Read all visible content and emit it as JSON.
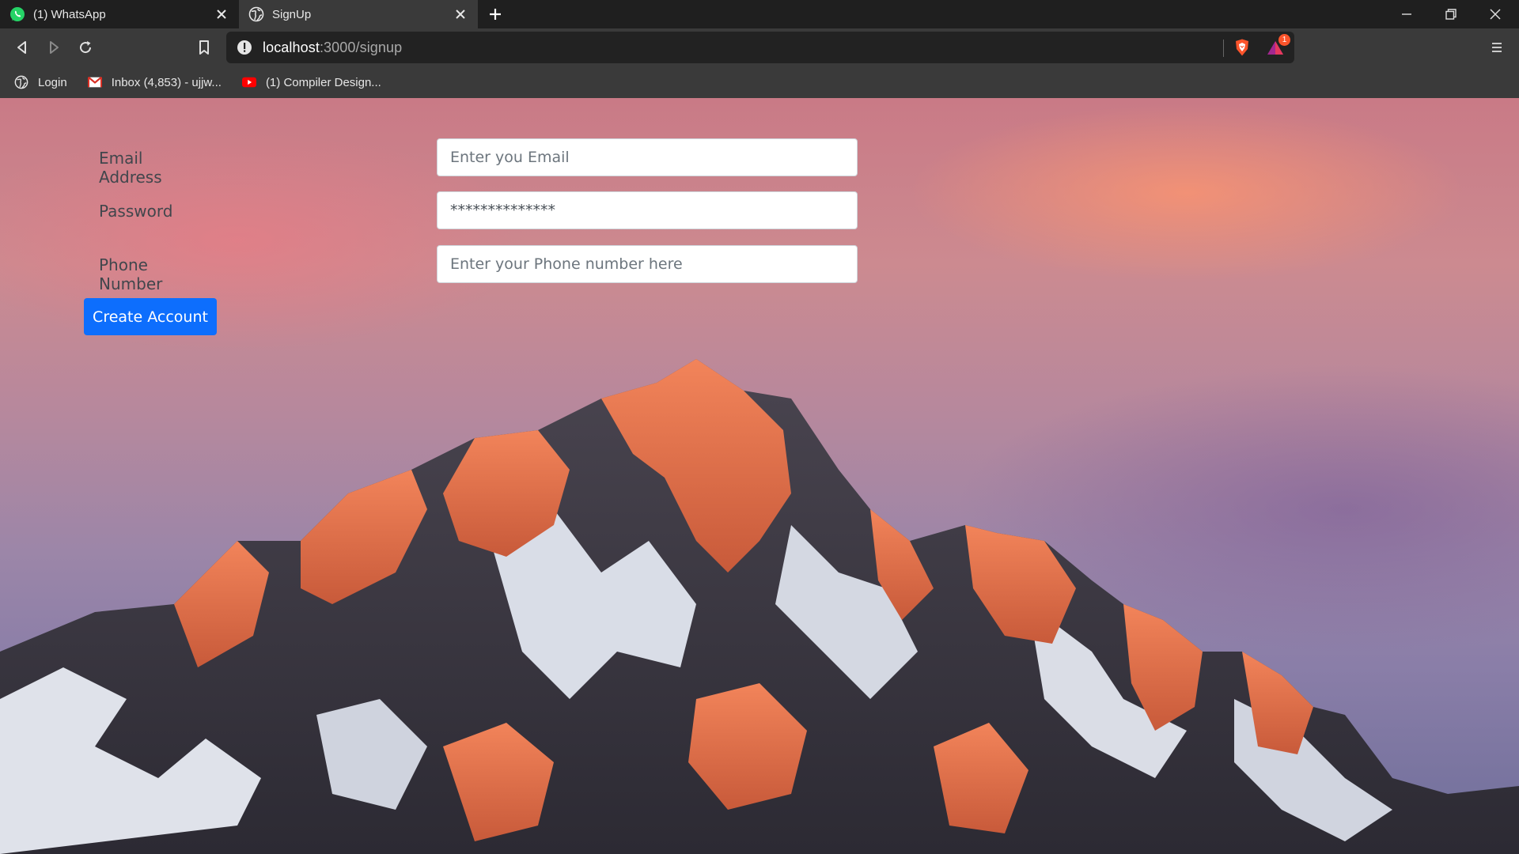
{
  "browser": {
    "tabs": [
      {
        "title": "(1) WhatsApp",
        "icon": "whatsapp-icon",
        "active": false
      },
      {
        "title": "SignUp",
        "icon": "globe-icon",
        "active": true
      }
    ],
    "address": {
      "host": "localhost",
      "path": ":3000/signup"
    },
    "bookmarks": [
      {
        "label": "Login",
        "icon": "globe-icon"
      },
      {
        "label": "Inbox (4,853) - ujjw...",
        "icon": "gmail-icon"
      },
      {
        "label": "(1) Compiler Design...",
        "icon": "youtube-icon"
      }
    ],
    "rewards_badge": "1"
  },
  "form": {
    "email": {
      "label": "Email Address",
      "placeholder": "Enter you Email"
    },
    "password": {
      "label": "Password",
      "value": "**************"
    },
    "phone": {
      "label": "Phone Number",
      "placeholder": "Enter your Phone number here"
    },
    "submit_label": "Create Account"
  },
  "colors": {
    "primary": "#0d6efd",
    "chrome_dark": "#1f1f1f",
    "chrome": "#3a3a3a"
  }
}
